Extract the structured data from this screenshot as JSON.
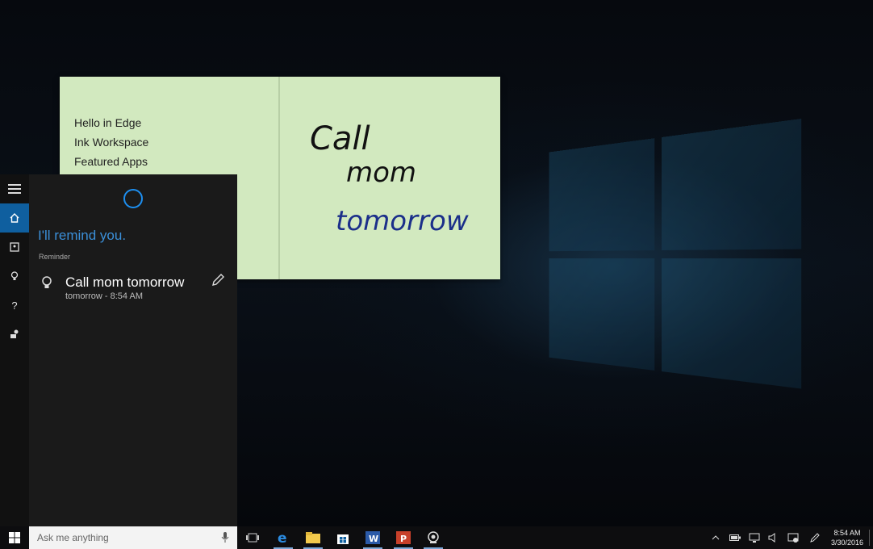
{
  "sticky_note": {
    "list": [
      "Hello in Edge",
      "Ink Workspace",
      "Featured Apps"
    ],
    "ink_lines": [
      "Call",
      "mom",
      "tomorrow"
    ]
  },
  "cortana": {
    "heading": "I'll remind you.",
    "section_label": "Reminder",
    "reminder": {
      "title": "Call mom tomorrow",
      "when": "tomorrow - 8:54 AM"
    },
    "rail": [
      "hamburger-menu",
      "home",
      "notebook",
      "reminders",
      "help",
      "feedback"
    ]
  },
  "taskbar": {
    "search_placeholder": "Ask me anything",
    "apps": [
      "task-view",
      "edge",
      "file-explorer",
      "store",
      "word",
      "powerpoint",
      "camera"
    ],
    "clock_time": "8:54 AM",
    "clock_date": "3/30/2016"
  },
  "colors": {
    "accent": "#0f5f9f",
    "cortana_blue": "#3b8fd8",
    "sticky_bg": "#d2e9bf",
    "ink_black": "#111111",
    "ink_blue": "#1b2f8a"
  }
}
